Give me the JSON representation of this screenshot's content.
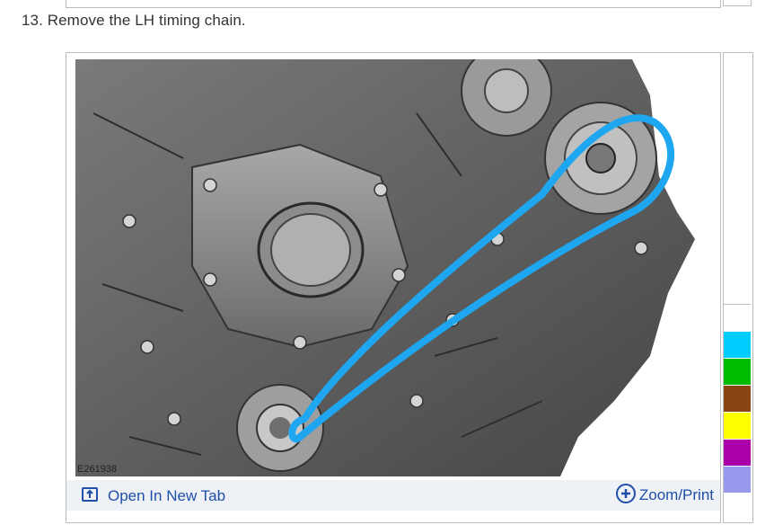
{
  "step": {
    "text": "13. Remove the LH timing chain."
  },
  "figure": {
    "id": "E261938",
    "chain_color": "#1ea7f0"
  },
  "links": {
    "open_new_tab": "Open In New Tab",
    "zoom_print": "Zoom/Print"
  },
  "palette": {
    "colors": [
      "#ffffff",
      "#00ccff",
      "#00bb00",
      "#8b4513",
      "#ffff00",
      "#aa00aa",
      "#9999ee"
    ]
  }
}
